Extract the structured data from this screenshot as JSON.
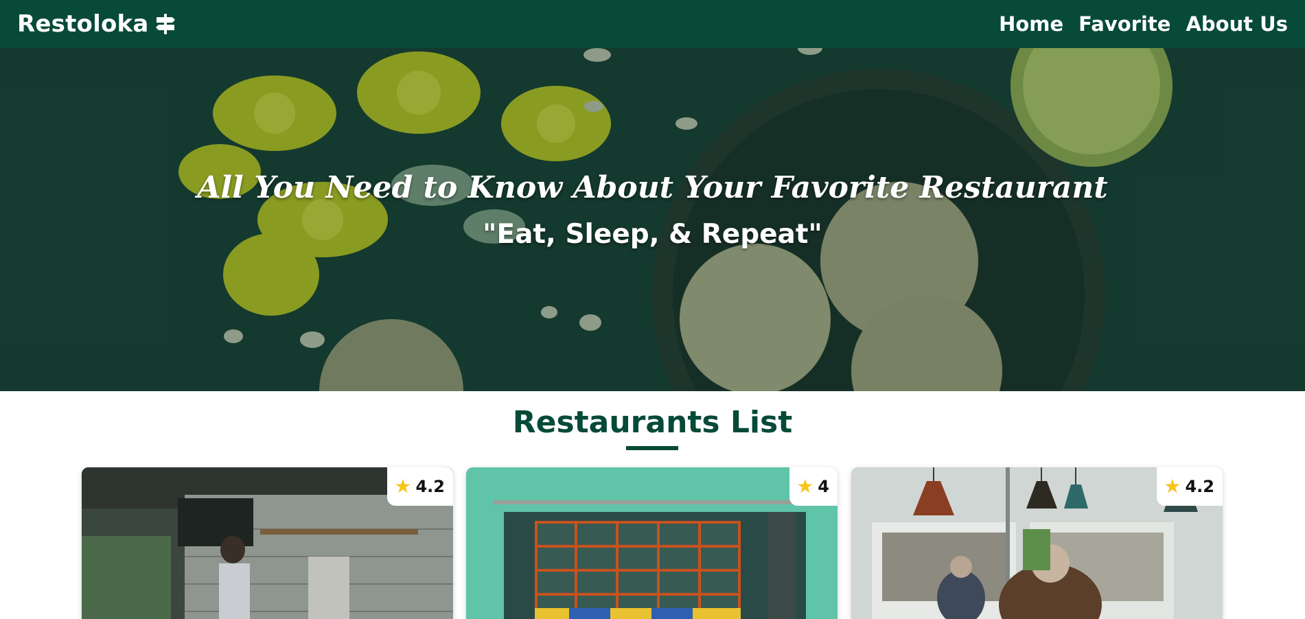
{
  "navbar": {
    "brand": "Restoloka",
    "brand_icon": "signpost-icon",
    "links": [
      "Home",
      "Favorite",
      "About Us"
    ]
  },
  "hero": {
    "title": "All You Need to Know About Your Favorite Restaurant",
    "tagline": "\"Eat, Sleep, & Repeat\""
  },
  "main": {
    "section_title": "Restaurants List",
    "restaurants": [
      {
        "rating": "4.2"
      },
      {
        "rating": "4"
      },
      {
        "rating": "4.2"
      }
    ]
  },
  "colors": {
    "brand_green": "#064a37",
    "star": "#f5c518"
  }
}
